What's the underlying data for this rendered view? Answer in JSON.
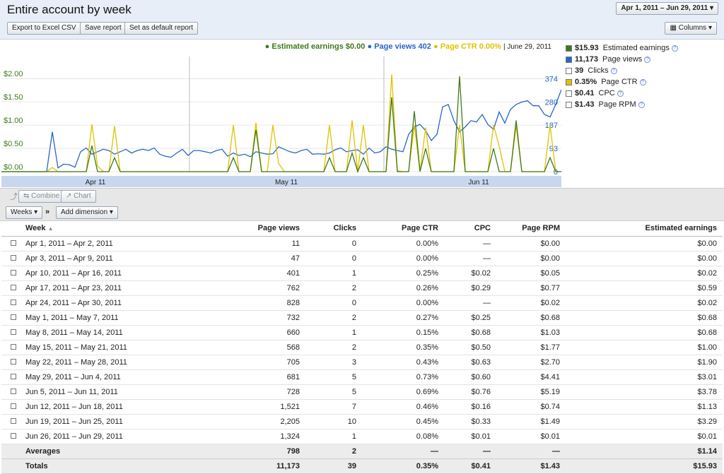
{
  "header": {
    "title": "Entire account by week",
    "date_range": "Apr 1, 2011 – Jun 29, 2011",
    "export_label": "Export to Excel CSV",
    "save_label": "Save report",
    "default_label": "Set as default report",
    "columns_label": "Columns"
  },
  "legend": {
    "earnings": "Estimated earnings $0.00",
    "pageviews": "Page views 402",
    "ctr": "Page CTR 0.00%",
    "date": "June 29, 2011",
    "colors": {
      "earnings": "#3d7a1a",
      "pageviews": "#2766c8",
      "ctr": "#e0c200"
    }
  },
  "metrics": [
    {
      "value": "$15.93",
      "label": "Estimated earnings",
      "checked": true,
      "color": "green"
    },
    {
      "value": "11,173",
      "label": "Page views",
      "checked": true,
      "color": "blue"
    },
    {
      "value": "39",
      "label": "Clicks",
      "checked": false,
      "color": ""
    },
    {
      "value": "0.35%",
      "label": "Page CTR",
      "checked": true,
      "color": "yellow"
    },
    {
      "value": "$0.41",
      "label": "CPC",
      "checked": false,
      "color": ""
    },
    {
      "value": "$1.43",
      "label": "Page RPM",
      "checked": false,
      "color": ""
    }
  ],
  "toolbar": {
    "combine_label": "Combine",
    "chart_label": "Chart",
    "weeks_label": "Weeks",
    "arrow_label": "»",
    "add_dimension_label": "Add dimension"
  },
  "table": {
    "headers": [
      "Week",
      "Page views",
      "Clicks",
      "Page CTR",
      "CPC",
      "Page RPM",
      "Estimated earnings"
    ],
    "rows": [
      [
        "Apr 1, 2011 – Apr 2, 2011",
        "11",
        "0",
        "0.00%",
        "—",
        "$0.00",
        "$0.00"
      ],
      [
        "Apr 3, 2011 – Apr 9, 2011",
        "47",
        "0",
        "0.00%",
        "—",
        "$0.00",
        "$0.00"
      ],
      [
        "Apr 10, 2011 – Apr 16, 2011",
        "401",
        "1",
        "0.25%",
        "$0.02",
        "$0.05",
        "$0.02"
      ],
      [
        "Apr 17, 2011 – Apr 23, 2011",
        "762",
        "2",
        "0.26%",
        "$0.29",
        "$0.77",
        "$0.59"
      ],
      [
        "Apr 24, 2011 – Apr 30, 2011",
        "828",
        "0",
        "0.00%",
        "—",
        "$0.02",
        "$0.02"
      ],
      [
        "May 1, 2011 – May 7, 2011",
        "732",
        "2",
        "0.27%",
        "$0.25",
        "$0.68",
        "$0.68"
      ],
      [
        "May 8, 2011 – May 14, 2011",
        "660",
        "1",
        "0.15%",
        "$0.68",
        "$1.03",
        "$0.68"
      ],
      [
        "May 15, 2011 – May 21, 2011",
        "568",
        "2",
        "0.35%",
        "$0.50",
        "$1.77",
        "$1.00"
      ],
      [
        "May 22, 2011 – May 28, 2011",
        "705",
        "3",
        "0.43%",
        "$0.63",
        "$2.70",
        "$1.90"
      ],
      [
        "May 29, 2011 – Jun 4, 2011",
        "681",
        "5",
        "0.73%",
        "$0.60",
        "$4.41",
        "$3.01"
      ],
      [
        "Jun 5, 2011 – Jun 11, 2011",
        "728",
        "5",
        "0.69%",
        "$0.76",
        "$5.19",
        "$3.78"
      ],
      [
        "Jun 12, 2011 – Jun 18, 2011",
        "1,521",
        "7",
        "0.46%",
        "$0.16",
        "$0.74",
        "$1.13"
      ],
      [
        "Jun 19, 2011 – Jun 25, 2011",
        "2,205",
        "10",
        "0.45%",
        "$0.33",
        "$1.49",
        "$3.29"
      ],
      [
        "Jun 26, 2011 – Jun 29, 2011",
        "1,324",
        "1",
        "0.08%",
        "$0.01",
        "$0.01",
        "$0.01"
      ]
    ],
    "averages": [
      "Averages",
      "798",
      "2",
      "—",
      "—",
      "—",
      "$1.14"
    ],
    "totals": [
      "Totals",
      "11,173",
      "39",
      "0.35%",
      "$0.41",
      "$1.43",
      "$15.93"
    ]
  },
  "chart_data": {
    "type": "line",
    "x_ticks": [
      "Apr 11",
      "May 11",
      "Jun 11"
    ],
    "y_left_ticks": [
      "$2.00",
      "$1.50",
      "$1.00",
      "$0.50",
      "$0.00"
    ],
    "y_right_ticks": [
      "374",
      "280",
      "187",
      "93",
      "0"
    ],
    "series": [
      {
        "name": "Page views",
        "axis": "right",
        "values": [
          0,
          0,
          0,
          0,
          0,
          0,
          0,
          0,
          0,
          160,
          15,
          30,
          28,
          18,
          80,
          95,
          70,
          80,
          90,
          85,
          70,
          80,
          90,
          75,
          85,
          90,
          85,
          95,
          70,
          62,
          58,
          75,
          90,
          65,
          85,
          85,
          80,
          75,
          85,
          90,
          62,
          75,
          65,
          70,
          60,
          80,
          75,
          70,
          72,
          100,
          90,
          80,
          75,
          85,
          90,
          70,
          72,
          70,
          75,
          88,
          95,
          80,
          85,
          88,
          70,
          95,
          75,
          80,
          100,
          90,
          85,
          80,
          150,
          180,
          190,
          165,
          125,
          150,
          260,
          270,
          205,
          160,
          180,
          205,
          200,
          230,
          190,
          170,
          240,
          195,
          250,
          270,
          280,
          285,
          265,
          265,
          230,
          220,
          270,
          330
        ]
      },
      {
        "name": "Page CTR",
        "axis": "left",
        "values": [
          0,
          0,
          0,
          0,
          0,
          0,
          0,
          0,
          0,
          0.09,
          0,
          0,
          0,
          0,
          0,
          0,
          1.02,
          0.12,
          0,
          0,
          0.98,
          0,
          0,
          0,
          0,
          0,
          0,
          0,
          0,
          0,
          0,
          0,
          0,
          0,
          0,
          0,
          0,
          0,
          0,
          0,
          0,
          1.0,
          0,
          0,
          0,
          1.05,
          0,
          0,
          1.0,
          0.18,
          0,
          0,
          0,
          0,
          0,
          0,
          0,
          0,
          1.0,
          0,
          0,
          0,
          1.1,
          0,
          1.0,
          0,
          0,
          0,
          0,
          2.09,
          0.02,
          0,
          0,
          1.0,
          0,
          0.95,
          0,
          0,
          0,
          0,
          0,
          1.0,
          0,
          0,
          0,
          0,
          0,
          1.0,
          0.55,
          0,
          0,
          0.98,
          0,
          0,
          0,
          0,
          0,
          1.0,
          0,
          0
        ]
      },
      {
        "name": "Estimated earnings",
        "axis": "left",
        "values": [
          0,
          0,
          0,
          0,
          0,
          0,
          0,
          0,
          0,
          0,
          0,
          0,
          0,
          0,
          0,
          0,
          0.56,
          0,
          0,
          0,
          0.3,
          0,
          0,
          0,
          0,
          0,
          0,
          0,
          0,
          0,
          0,
          0,
          0,
          0,
          0,
          0,
          0,
          0,
          0,
          0,
          0,
          0.3,
          0,
          0,
          0,
          0.9,
          0,
          0,
          0,
          0,
          0,
          0,
          0,
          0,
          0,
          0,
          0,
          0,
          0.3,
          0,
          0,
          0,
          0.4,
          0,
          0.3,
          0,
          0,
          0,
          0,
          1.6,
          0,
          0,
          0,
          1.3,
          0,
          0.5,
          0,
          0,
          0,
          0,
          0,
          2.05,
          0,
          0,
          0,
          0,
          0,
          0.5,
          0,
          0,
          0,
          1.1,
          0,
          0,
          0,
          0,
          0,
          0.3,
          0,
          0
        ]
      }
    ],
    "y_left_range": [
      0,
      2.17
    ],
    "y_right_range": [
      0,
      406
    ]
  }
}
